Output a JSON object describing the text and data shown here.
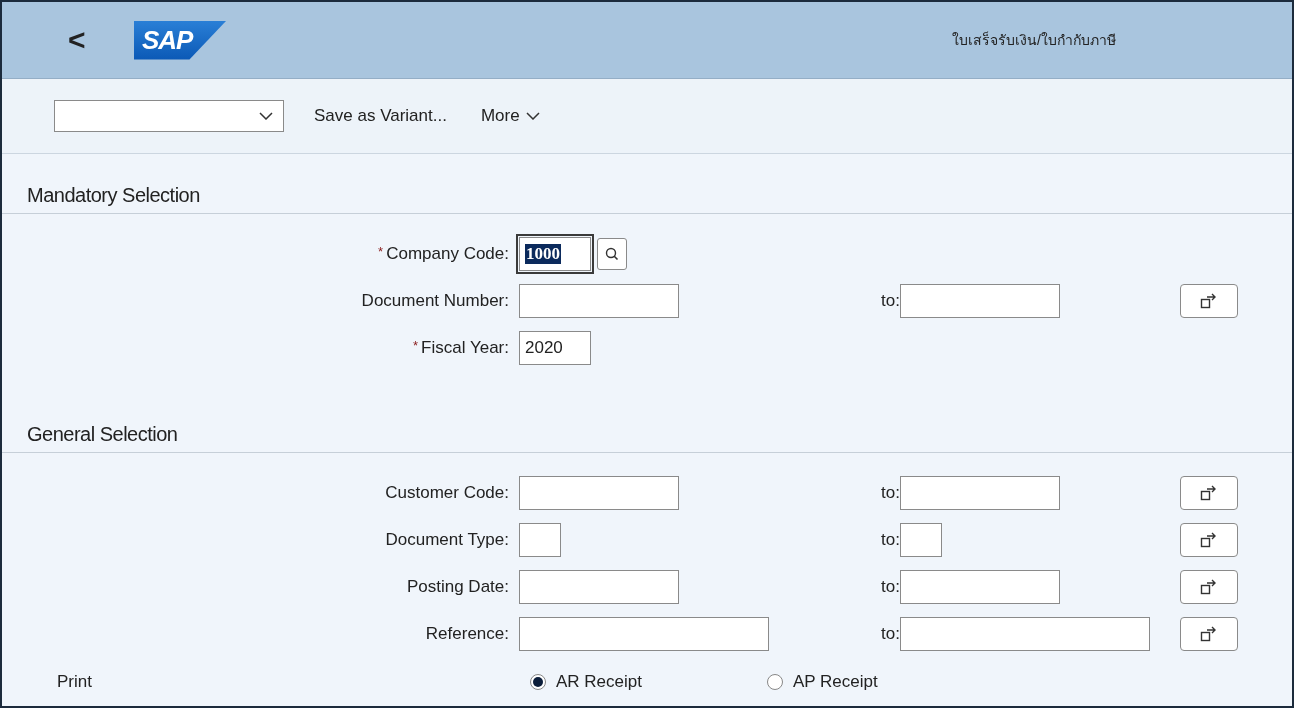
{
  "header": {
    "back": "<",
    "logo": "SAP",
    "title": "ใบเสร็จรับเงิน/ใบกำกับภาษี"
  },
  "toolbar": {
    "save": "Save as Variant...",
    "more": "More"
  },
  "sections": [
    {
      "title": "Mandatory Selection",
      "fields": [
        {
          "label": "Company Code:",
          "required_mark": "*",
          "value": "1000",
          "kind": "code",
          "focused": true,
          "value_help": true
        },
        {
          "label": "Document Number:",
          "kind": "medium",
          "to": {
            "label": "to:"
          },
          "multiple": true
        },
        {
          "label": "Fiscal Year:",
          "required_mark": "*",
          "value": "2020",
          "kind": "code",
          "focused": false
        }
      ]
    },
    {
      "title": "General Selection",
      "fields": [
        {
          "label": "Customer Code:",
          "kind": "medium",
          "to": {
            "label": "to:"
          },
          "multiple": true
        },
        {
          "label": "Document Type:",
          "kind": "short",
          "to": {
            "label": "to:"
          },
          "multiple": true
        },
        {
          "label": "Posting Date:",
          "kind": "medium",
          "to": {
            "label": "to:"
          },
          "multiple": true
        },
        {
          "label": "Reference:",
          "kind": "long",
          "to": {
            "label": "to:"
          },
          "multiple": true
        }
      ]
    }
  ],
  "print": {
    "label": "Print",
    "options": [
      {
        "label": "AR Receipt",
        "selected": true
      },
      {
        "label": "AP Receipt",
        "selected": false
      }
    ]
  }
}
